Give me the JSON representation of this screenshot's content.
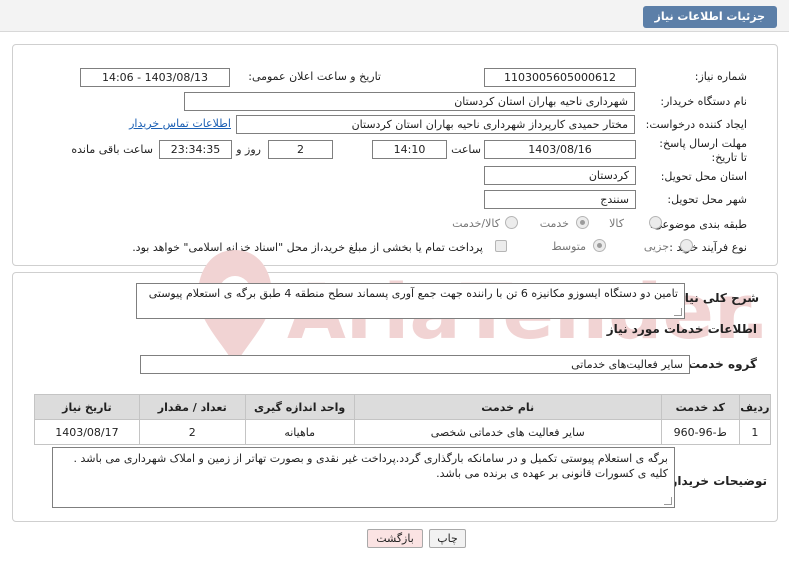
{
  "header": {
    "title": "جزئیات اطلاعات نیاز"
  },
  "form": {
    "need_number_label": "شماره نیاز:",
    "need_number": "1103005605000612",
    "announce_label": "تاریخ و ساعت اعلان عمومی:",
    "announce_value": "1403/08/13 - 14:06",
    "buyer_org_label": "نام دستگاه خریدار:",
    "buyer_org": "شهرداری ناحیه بهاران استان کردستان",
    "creator_label": "ایجاد کننده درخواست:",
    "creator": "مختار حمیدی کارپرداز شهرداری ناحیه بهاران استان کردستان",
    "contact_link": "اطلاعات تماس خریدار",
    "deadline_label": "مهلت ارسال پاسخ: تا تاریخ:",
    "deadline_date": "1403/08/16",
    "time_label": "ساعت",
    "deadline_time": "14:10",
    "days_value": "2",
    "days_label": "روز و",
    "remaining_time": "23:34:35",
    "remaining_label": "ساعت باقی مانده",
    "province_label": "استان محل تحویل:",
    "province": "کردستان",
    "city_label": "شهر محل تحویل:",
    "city": "سنندج",
    "category_label": "طبقه بندی موضوعی:",
    "category_options": [
      "کالا",
      "خدمت",
      "کالا/خدمت"
    ],
    "category_selected": "خدمت",
    "process_label": "نوع فرآیند خرید :",
    "process_options": [
      "جزیی",
      "متوسط"
    ],
    "process_selected": "متوسط",
    "payment_note": "پرداخت تمام یا بخشی از مبلغ خرید،از محل \"اسناد خزانه اسلامی\" خواهد بود."
  },
  "summary": {
    "label": "شرح کلی نیاز:",
    "text": "تامین دو دستگاه ایسوزو مکانیزه 6 تن با راننده جهت جمع آوری پسماند سطح منطقه 4 طبق برگه ی استعلام پیوستی"
  },
  "services": {
    "section_title": "اطلاعات خدمات مورد نیاز",
    "group_label": "گروه خدمت:",
    "group_value": "سایر فعالیت‌های خدماتی",
    "columns": [
      "ردیف",
      "کد خدمت",
      "نام خدمت",
      "واحد اندازه گیری",
      "تعداد / مقدار",
      "تاریخ نیاز"
    ],
    "rows": [
      {
        "row": "1",
        "code": "ط-96-960",
        "name": "سایر فعالیت های خدماتی شخصی",
        "unit": "ماهیانه",
        "qty": "2",
        "date": "1403/08/17"
      }
    ]
  },
  "buyer_notes": {
    "label": "توضیحات خریدار:",
    "text": "برگه ی استعلام پیوستی تکمیل و در سامانکه بارگذاری گردد.پرداخت غیر نقدی و بصورت تهاتر از زمین و املاک شهرداری می باشد . کلیه ی کسورات قانونی بر عهده ی برنده می باشد."
  },
  "buttons": {
    "print": "چاپ",
    "back": "بازگشت"
  },
  "watermark": {
    "text": "AriaTender.neT"
  },
  "colors": {
    "header_bg": "#5c7fa8",
    "back_button_bg": "#fbe3e3",
    "watermark": "#f1d3d3"
  }
}
